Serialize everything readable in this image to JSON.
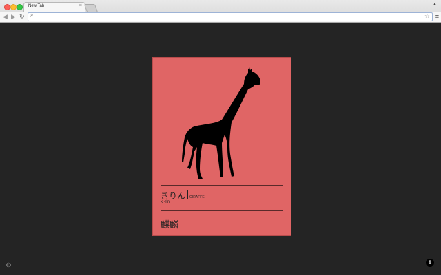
{
  "browser": {
    "tab_title": "New Tab",
    "tab_close": "×",
    "omnibox_value": "",
    "omnibox_placeholder": ""
  },
  "card": {
    "reading": "きりん",
    "english": "GIRAFFE",
    "romaji": "ki·rin",
    "kanji": "麒麟",
    "background_color": "#e06565",
    "image": "giraffe-silhouette"
  },
  "icons": {
    "back": "◀",
    "forward": "▶",
    "reload": "↻",
    "search": "⌕",
    "star": "☆",
    "menu": "≡",
    "user": "▲",
    "settings": "⚙",
    "info": "i"
  }
}
